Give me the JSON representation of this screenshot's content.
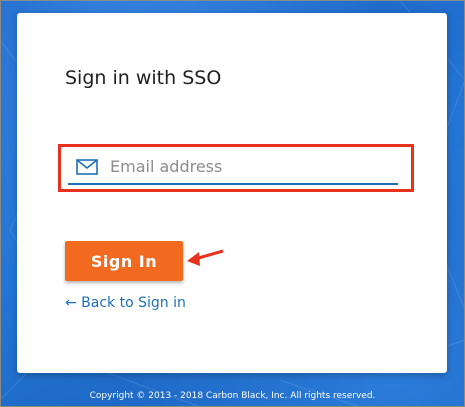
{
  "card": {
    "title": "Sign in with SSO"
  },
  "email": {
    "icon": "mail-icon",
    "placeholder": "Email address",
    "value": ""
  },
  "signin": {
    "label": "Sign In"
  },
  "back": {
    "label": "← Back to Sign in"
  },
  "footer": {
    "copyright": "Copyright © 2013 - 2018 Carbon Black, Inc. All rights reserved."
  },
  "colors": {
    "brand_orange": "#f26a1f",
    "link_blue": "#1f6fb8",
    "annotation_red": "#e8321e",
    "background_blue": "#1e6fd0"
  }
}
